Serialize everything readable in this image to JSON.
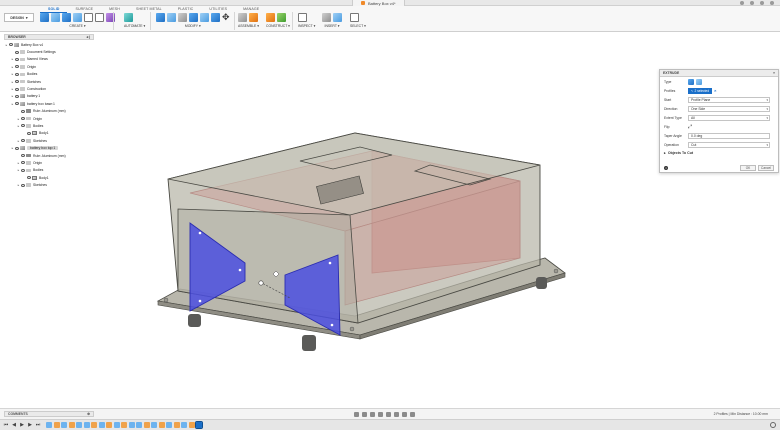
{
  "title_bar": {
    "document_title": "Battery Box v4*"
  },
  "ribbon": {
    "workspace_label": "DESIGN",
    "tabs": [
      "SOLID",
      "SURFACE",
      "MESH",
      "SHEET METAL",
      "PLASTIC",
      "UTILITIES",
      "MANAGE"
    ],
    "active_tab": "SOLID",
    "groups": [
      "CREATE",
      "AUTOMATE",
      "MODIFY",
      "ASSEMBLE",
      "CONSTRUCT",
      "INSPECT",
      "INSERT",
      "SELECT"
    ]
  },
  "browser": {
    "title": "BROWSER",
    "items": [
      {
        "label": "Battery Box v4",
        "indent": 0,
        "icon": "doc"
      },
      {
        "label": "Document Settings",
        "indent": 1,
        "icon": "gear"
      },
      {
        "label": "Named Views",
        "indent": 1,
        "icon": "folder"
      },
      {
        "label": "Origin",
        "indent": 1,
        "icon": "folder"
      },
      {
        "label": "Bodies",
        "indent": 1,
        "icon": "folder"
      },
      {
        "label": "Sketches",
        "indent": 1,
        "icon": "folder"
      },
      {
        "label": "Construction",
        "indent": 1,
        "icon": "folder"
      },
      {
        "label": "battery:1",
        "indent": 1,
        "icon": "component"
      },
      {
        "label": "battery box base:1",
        "indent": 1,
        "icon": "component"
      },
      {
        "label": "Rule: Aluminum (mm)",
        "indent": 2,
        "icon": "material"
      },
      {
        "label": "Origin",
        "indent": 2,
        "icon": "folder"
      },
      {
        "label": "Bodies",
        "indent": 2,
        "icon": "folder"
      },
      {
        "label": "Body1",
        "indent": 3,
        "icon": "body"
      },
      {
        "label": "Sketches",
        "indent": 2,
        "icon": "folder"
      },
      {
        "label": "battery box top:1",
        "indent": 1,
        "icon": "component",
        "highlight": true
      },
      {
        "label": "Rule: Aluminum (mm)",
        "indent": 2,
        "icon": "material"
      },
      {
        "label": "Origin",
        "indent": 2,
        "icon": "folder"
      },
      {
        "label": "Bodies",
        "indent": 2,
        "icon": "folder"
      },
      {
        "label": "Body1",
        "indent": 3,
        "icon": "body"
      },
      {
        "label": "Sketches",
        "indent": 2,
        "icon": "folder"
      }
    ]
  },
  "extrude": {
    "title": "EXTRUDE",
    "rows": [
      {
        "label": "Type",
        "kind": "icons"
      },
      {
        "label": "Profiles",
        "kind": "selection",
        "value": "2 selected"
      },
      {
        "label": "Start",
        "kind": "dropdown",
        "value": "Profile Plane"
      },
      {
        "label": "Direction",
        "kind": "dropdown",
        "value": "One Side"
      },
      {
        "label": "Extent Type",
        "kind": "dropdown",
        "value": "All"
      },
      {
        "label": "Flip",
        "kind": "icon"
      },
      {
        "label": "Taper Angle",
        "kind": "text",
        "value": "0.0 deg"
      },
      {
        "label": "Operation",
        "kind": "dropdown",
        "value": "Cut"
      }
    ],
    "section": "Objects To Cut",
    "ok_label": "OK",
    "cancel_label": "Cancel"
  },
  "bottom": {
    "comments_label": "COMMENTS",
    "status_text": "2 Profiles | Min Distance : 10.00 mm"
  },
  "timeline": {
    "items": [
      "sk",
      "ex",
      "sk",
      "ex",
      "sk",
      "sk",
      "ex",
      "sk",
      "ex",
      "sk",
      "ex",
      "sk",
      "sk",
      "ex",
      "sk",
      "ex",
      "sk",
      "ex",
      "sk",
      "ex",
      "cur"
    ]
  },
  "colors": {
    "accent": "#1a6fc9",
    "cut_red": "#ff4a55",
    "profile_blue": "#4b4fe0",
    "metal": "#b7b5a8"
  }
}
